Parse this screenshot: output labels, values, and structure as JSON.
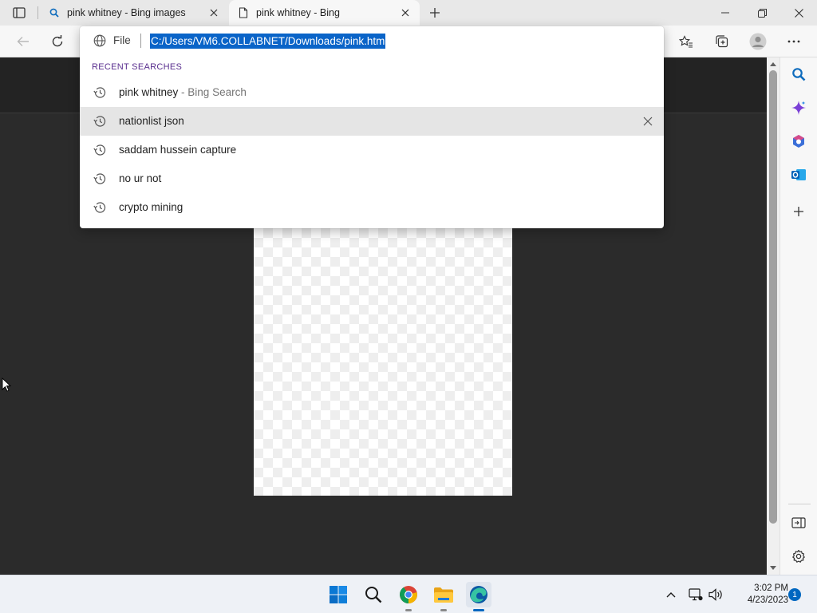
{
  "tabs": [
    {
      "title": "pink whitney - Bing images",
      "icon": "search-icon",
      "active": false
    },
    {
      "title": "pink whitney - Bing",
      "icon": "page-icon",
      "active": true
    }
  ],
  "address": {
    "scheme": "File",
    "url": "C:/Users/VM6.COLLABNET/Downloads/pink.htm"
  },
  "omnibox": {
    "section_label": "RECENT SEARCHES",
    "suggestions": [
      {
        "text": "pink whitney",
        "suffix": " - Bing Search",
        "highlighted": false
      },
      {
        "text": "nationlist json",
        "suffix": "",
        "highlighted": true
      },
      {
        "text": "saddam hussein capture",
        "suffix": "",
        "highlighted": false
      },
      {
        "text": "no ur not",
        "suffix": "",
        "highlighted": false
      },
      {
        "text": "crypto mining",
        "suffix": "",
        "highlighted": false
      }
    ]
  },
  "taskbar": {
    "time": "3:02 PM",
    "date": "4/23/2023",
    "notification_count": "1",
    "apps": [
      "start-icon",
      "search-icon",
      "chrome-icon",
      "file-explorer-icon",
      "edge-icon"
    ]
  },
  "colors": {
    "selection": "#0a64c8",
    "accent": "#0067c0",
    "section_label": "#5a2f8f"
  }
}
